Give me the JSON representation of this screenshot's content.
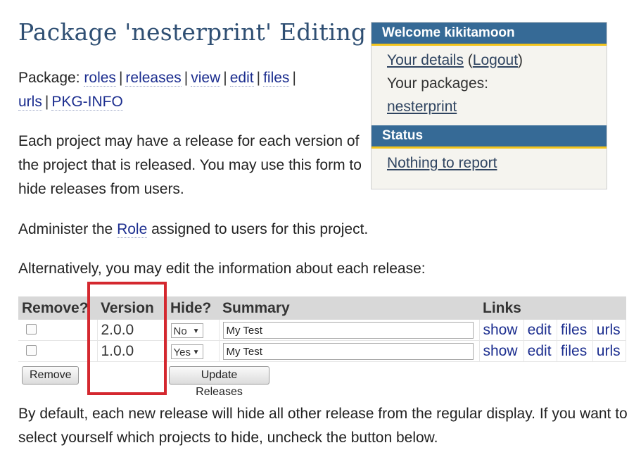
{
  "page_title": "Package 'nesterprint' Editing",
  "package_nav": {
    "prefix": "Package:",
    "links": [
      "roles",
      "releases",
      "view",
      "edit",
      "files",
      "urls",
      "PKG-INFO"
    ]
  },
  "intro_text": "Each project may have a release for each version of the project that is released. You may use this form to hide releases from users.",
  "role_text": {
    "before": "Administer the ",
    "link": "Role",
    "after": " assigned to users for this project."
  },
  "alt_text": "Alternatively, you may edit the information about each release:",
  "sidebar": {
    "welcome_heading": "Welcome kikitamoon",
    "your_details": "Your details",
    "logout": "Logout",
    "your_packages_label": "Your packages:",
    "package_link": "nesterprint",
    "status_heading": "Status",
    "status_text": "Nothing to report"
  },
  "releases_table": {
    "headers": [
      "Remove?",
      "Version",
      "Hide?",
      "Summary",
      "Links"
    ],
    "rows": [
      {
        "version": "2.0.0",
        "hide": "No",
        "summary": "My Test",
        "links": [
          "show",
          "edit",
          "files",
          "urls"
        ]
      },
      {
        "version": "1.0.0",
        "hide": "Yes",
        "summary": "My Test",
        "links": [
          "show",
          "edit",
          "files",
          "urls"
        ]
      }
    ]
  },
  "buttons": {
    "remove": "Remove",
    "update": "Update Releases"
  },
  "bottom_text": "By default, each new release will hide all other release from the regular display. If you want to select yourself which projects to hide, uncheck the button below.",
  "colors": {
    "title": "#2f4f73",
    "link": "#1c2e8f",
    "sidebar_header": "#366a96",
    "sidebar_accent": "#f2c41d",
    "highlight_box": "#d4282f"
  }
}
